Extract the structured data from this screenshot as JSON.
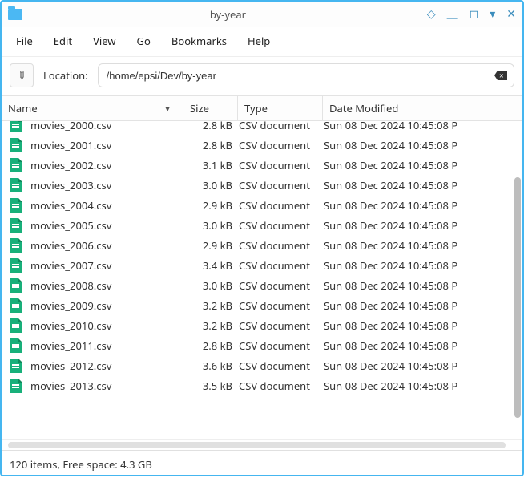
{
  "window": {
    "title": "by-year"
  },
  "menu": {
    "file": "File",
    "edit": "Edit",
    "view": "View",
    "go": "Go",
    "bookmarks": "Bookmarks",
    "help": "Help"
  },
  "location": {
    "label": "Location:",
    "path": "/home/epsi/Dev/by-year"
  },
  "columns": {
    "name": "Name",
    "size": "Size",
    "type": "Type",
    "date": "Date Modified"
  },
  "files": [
    {
      "name": "movies_2000.csv",
      "size": "2.8 kB",
      "type": "CSV document",
      "date": "Sun 08 Dec 2024 10:45:08 P"
    },
    {
      "name": "movies_2001.csv",
      "size": "2.8 kB",
      "type": "CSV document",
      "date": "Sun 08 Dec 2024 10:45:08 P"
    },
    {
      "name": "movies_2002.csv",
      "size": "3.1 kB",
      "type": "CSV document",
      "date": "Sun 08 Dec 2024 10:45:08 P"
    },
    {
      "name": "movies_2003.csv",
      "size": "3.0 kB",
      "type": "CSV document",
      "date": "Sun 08 Dec 2024 10:45:08 P"
    },
    {
      "name": "movies_2004.csv",
      "size": "2.9 kB",
      "type": "CSV document",
      "date": "Sun 08 Dec 2024 10:45:08 P"
    },
    {
      "name": "movies_2005.csv",
      "size": "3.0 kB",
      "type": "CSV document",
      "date": "Sun 08 Dec 2024 10:45:08 P"
    },
    {
      "name": "movies_2006.csv",
      "size": "2.9 kB",
      "type": "CSV document",
      "date": "Sun 08 Dec 2024 10:45:08 P"
    },
    {
      "name": "movies_2007.csv",
      "size": "3.4 kB",
      "type": "CSV document",
      "date": "Sun 08 Dec 2024 10:45:08 P"
    },
    {
      "name": "movies_2008.csv",
      "size": "3.0 kB",
      "type": "CSV document",
      "date": "Sun 08 Dec 2024 10:45:08 P"
    },
    {
      "name": "movies_2009.csv",
      "size": "3.2 kB",
      "type": "CSV document",
      "date": "Sun 08 Dec 2024 10:45:08 P"
    },
    {
      "name": "movies_2010.csv",
      "size": "3.2 kB",
      "type": "CSV document",
      "date": "Sun 08 Dec 2024 10:45:08 P"
    },
    {
      "name": "movies_2011.csv",
      "size": "2.8 kB",
      "type": "CSV document",
      "date": "Sun 08 Dec 2024 10:45:08 P"
    },
    {
      "name": "movies_2012.csv",
      "size": "3.6 kB",
      "type": "CSV document",
      "date": "Sun 08 Dec 2024 10:45:08 P"
    },
    {
      "name": "movies_2013.csv",
      "size": "3.5 kB",
      "type": "CSV document",
      "date": "Sun 08 Dec 2024 10:45:08 P"
    }
  ],
  "status": {
    "text": "120 items, Free space: 4.3 GB"
  }
}
